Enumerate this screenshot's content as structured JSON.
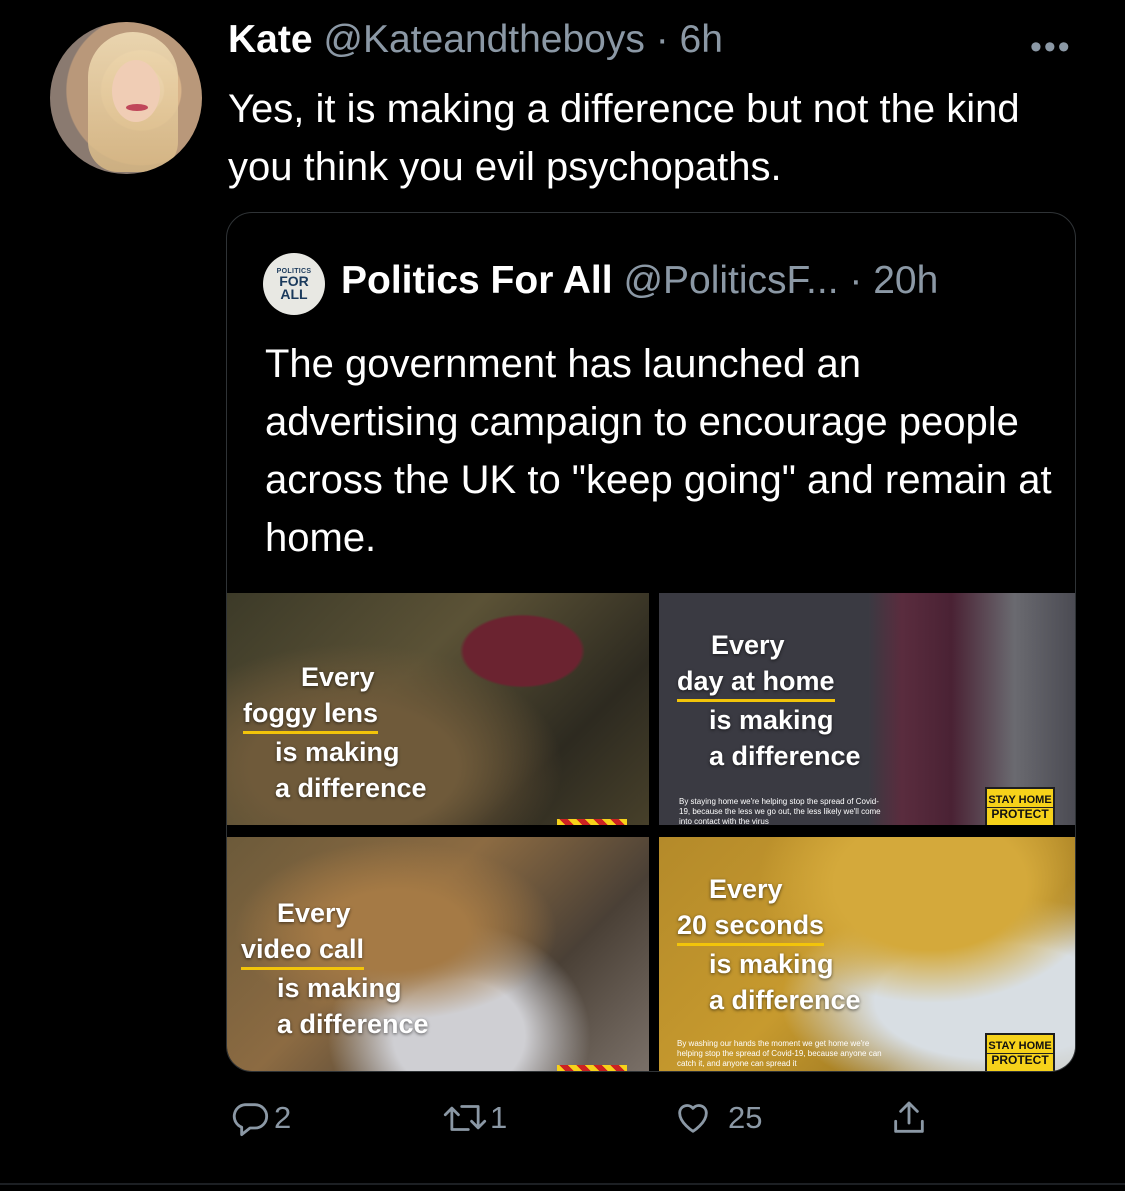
{
  "tweet": {
    "name": "Kate",
    "handle": "@Kateandtheboys",
    "time": "· 6h",
    "text": "Yes, it is making a difference but not the kind you think you evil psychopaths.",
    "more": "•••"
  },
  "quoted": {
    "avatar_text": [
      "POLITICS",
      "FOR",
      "ALL"
    ],
    "name": "Politics For All",
    "handle": "@PoliticsF...",
    "time": "· 20h",
    "text": "The government has launched an advertising campaign to encourage people across the UK to \"keep going\" and remain at home.",
    "images": [
      {
        "lines": [
          "Every",
          "foggy lens",
          "is making",
          "a difference"
        ],
        "underline": 1
      },
      {
        "lines": [
          "Every",
          "day at home",
          "is making",
          "a difference"
        ],
        "underline": 1,
        "fine": "By staying home we're helping stop the spread of Covid-19, because the less we go out, the less likely we'll come into contact with the virus",
        "badge": [
          "STAY HOME",
          "PROTECT"
        ]
      },
      {
        "lines": [
          "Every",
          "video call",
          "is making",
          "a difference"
        ],
        "underline": 1
      },
      {
        "lines": [
          "Every",
          "20 seconds",
          "is making",
          "a difference"
        ],
        "underline": 1,
        "fine": "By washing our hands the moment we get home we're helping stop the spread of Covid-19, because anyone can catch it, and anyone can spread it",
        "badge": [
          "STAY HOME",
          "PROTECT"
        ]
      }
    ]
  },
  "actions": {
    "reply_count": "2",
    "retweet_count": "1",
    "like_count": "25"
  },
  "icons": [
    "reply-icon",
    "retweet-icon",
    "like-icon",
    "share-icon",
    "more-icon"
  ]
}
